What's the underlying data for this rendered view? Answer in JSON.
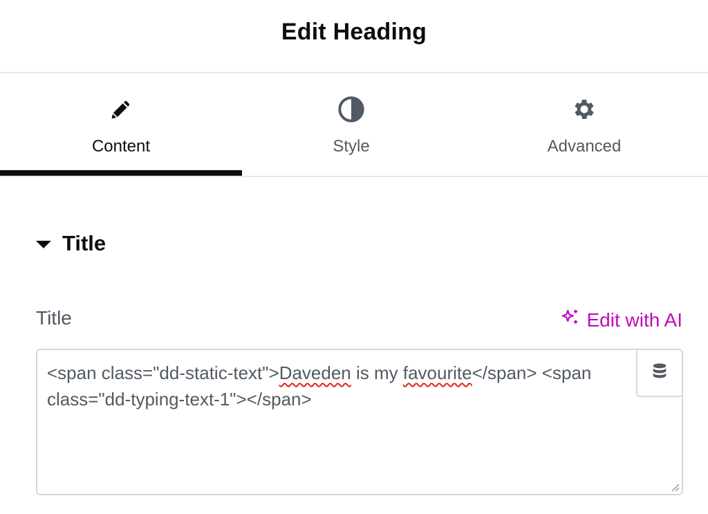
{
  "header": {
    "title": "Edit Heading"
  },
  "tabs": [
    {
      "label": "Content",
      "icon": "pencil-icon",
      "active": true
    },
    {
      "label": "Style",
      "icon": "half-circle-icon",
      "active": false
    },
    {
      "label": "Advanced",
      "icon": "gear-icon",
      "active": false
    }
  ],
  "section": {
    "title": "Title",
    "icon": "caret-down-icon"
  },
  "field": {
    "label": "Title",
    "ai_link": {
      "label": "Edit with AI",
      "icon": "sparkles-icon"
    },
    "value_parts": [
      "<span class=\"dd-static-text\">",
      "Daveden",
      " is my ",
      "favourite",
      "</span> <span class=\"dd-typing-text-1\"></span>"
    ],
    "dynamic_tags_icon": "database-icon"
  },
  "colors": {
    "text_primary": "#0c0d0e",
    "text_secondary": "#515962",
    "accent_ai": "#c00bb9",
    "border": "#d5d8dc",
    "spellcheck": "#e0251d"
  }
}
